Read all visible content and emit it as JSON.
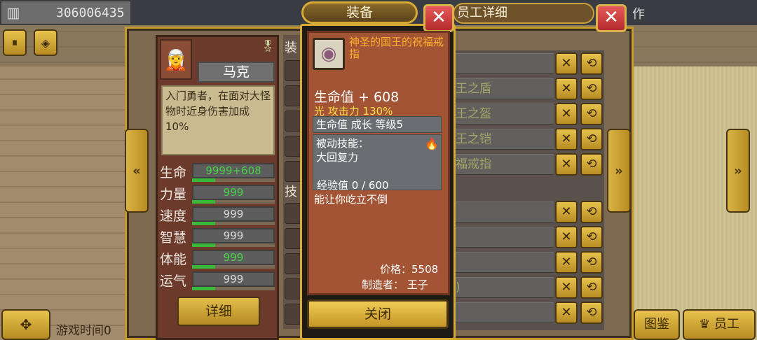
{
  "gold": {
    "icon": "building-icon",
    "value": "306006435"
  },
  "top_buttons": {
    "pause_icon": "pause-icon",
    "pause_glyph": "⏸",
    "gems_icon": "gems-icon",
    "gems_glyph": "◈"
  },
  "character": {
    "name": "马克",
    "description": "入门勇者，在面对大怪物时近身伤害加成10%",
    "stats": [
      {
        "label": "生命",
        "value": "9999+608",
        "green": true
      },
      {
        "label": "力量",
        "value": "999",
        "green": true
      },
      {
        "label": "速度",
        "value": "999",
        "green": false
      },
      {
        "label": "智慧",
        "value": "999",
        "green": false
      },
      {
        "label": "体能",
        "value": "999",
        "green": true
      },
      {
        "label": "运气",
        "value": "999",
        "green": false
      }
    ],
    "detail_button": "详细"
  },
  "middle_labels": {
    "equip": "装",
    "skill": "技"
  },
  "equipment_list": [
    {
      "name": ""
    },
    {
      "name": "王之盾"
    },
    {
      "name": "王之盔"
    },
    {
      "name": "王之铠"
    },
    {
      "name": "福戒指"
    },
    {
      "name": ""
    },
    {
      "name": ""
    },
    {
      "name": ""
    },
    {
      "name": ")"
    },
    {
      "name": ""
    }
  ],
  "background_dialog": {
    "title": "员工详细",
    "partial_title": "作"
  },
  "equip_popup": {
    "tab": "装备",
    "item_name": "神圣的国王的祝福戒指",
    "hp_bonus": "生命值 + 608",
    "light_attack": "光 攻击力 130%",
    "growth": "生命值 成长 等级5",
    "passive_label": "被动技能：",
    "passive_name": "大回复力",
    "exp": "经验值 0 / 600",
    "quote": "能让你屹立不倒",
    "price": "价格：5508",
    "maker": "制造者： 王子",
    "close": "关闭"
  },
  "bottom": {
    "game_time": "游戏时间0",
    "encyclopedia": "图鉴",
    "staff": "员工"
  },
  "icons": {
    "close": "✕",
    "arrow_left": "«",
    "arrow_right": "»",
    "equip_x": "✕",
    "equip_swap": "⟲",
    "dpad": "✥",
    "staff": "♛",
    "ring": "◉",
    "fire": "🔥",
    "hero": "🧝"
  }
}
